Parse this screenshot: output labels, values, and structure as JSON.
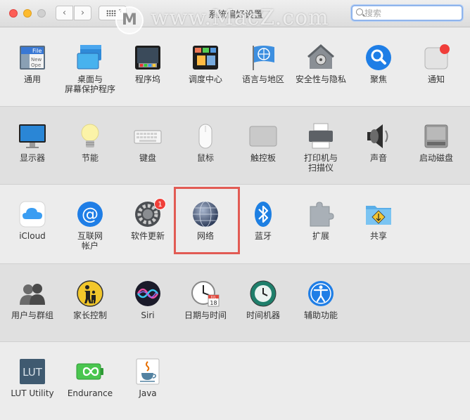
{
  "window": {
    "title": "系统偏好设置",
    "search_placeholder": "搜索",
    "back_glyph": "‹",
    "forward_glyph": "›",
    "grid_caret": "▾"
  },
  "watermark": {
    "logo": "M",
    "text": "www.MacZ.com"
  },
  "sections": [
    {
      "items": [
        {
          "key": "general",
          "label": "通用",
          "icon": "general-icon"
        },
        {
          "key": "desktop",
          "label": "桌面与\n屏幕保护程序",
          "icon": "desktop-icon"
        },
        {
          "key": "dock",
          "label": "程序坞",
          "icon": "dock-icon"
        },
        {
          "key": "mission",
          "label": "调度中心",
          "icon": "mission-control-icon"
        },
        {
          "key": "language",
          "label": "语言与地区",
          "icon": "globe-flag-icon"
        },
        {
          "key": "security",
          "label": "安全性与隐私",
          "icon": "security-house-icon"
        },
        {
          "key": "spotlight",
          "label": "聚焦",
          "icon": "spotlight-icon"
        },
        {
          "key": "notifications",
          "label": "通知",
          "icon": "notifications-icon"
        }
      ]
    },
    {
      "items": [
        {
          "key": "displays",
          "label": "显示器",
          "icon": "display-icon"
        },
        {
          "key": "energy",
          "label": "节能",
          "icon": "lightbulb-icon"
        },
        {
          "key": "keyboard",
          "label": "键盘",
          "icon": "keyboard-icon"
        },
        {
          "key": "mouse",
          "label": "鼠标",
          "icon": "mouse-icon"
        },
        {
          "key": "trackpad",
          "label": "触控板",
          "icon": "trackpad-icon"
        },
        {
          "key": "printers",
          "label": "打印机与\n扫描仪",
          "icon": "printer-icon"
        },
        {
          "key": "sound",
          "label": "声音",
          "icon": "speaker-icon"
        },
        {
          "key": "startup",
          "label": "启动磁盘",
          "icon": "disk-icon"
        }
      ]
    },
    {
      "items": [
        {
          "key": "icloud",
          "label": "iCloud",
          "icon": "icloud-icon"
        },
        {
          "key": "internet",
          "label": "互联网\n帐户",
          "icon": "at-sign-icon"
        },
        {
          "key": "software",
          "label": "软件更新",
          "icon": "gear-update-icon",
          "badge": "1"
        },
        {
          "key": "network",
          "label": "网络",
          "icon": "network-globe-icon"
        },
        {
          "key": "bluetooth",
          "label": "蓝牙",
          "icon": "bluetooth-icon"
        },
        {
          "key": "extensions",
          "label": "扩展",
          "icon": "puzzle-icon"
        },
        {
          "key": "sharing",
          "label": "共享",
          "icon": "sharing-folder-icon"
        }
      ]
    },
    {
      "items": [
        {
          "key": "users",
          "label": "用户与群组",
          "icon": "users-icon"
        },
        {
          "key": "parental",
          "label": "家长控制",
          "icon": "parental-icon"
        },
        {
          "key": "siri",
          "label": "Siri",
          "icon": "siri-icon"
        },
        {
          "key": "datetime",
          "label": "日期与时间",
          "icon": "clock-calendar-icon",
          "cal_month": "JUL",
          "cal_day": "18"
        },
        {
          "key": "timemachine",
          "label": "时间机器",
          "icon": "time-machine-icon"
        },
        {
          "key": "accessibility",
          "label": "辅助功能",
          "icon": "accessibility-icon"
        }
      ]
    },
    {
      "items": [
        {
          "key": "lut",
          "label": "LUT Utility",
          "icon": "lut-icon",
          "icon_text": "LUT"
        },
        {
          "key": "endurance",
          "label": "Endurance",
          "icon": "battery-infinity-icon"
        },
        {
          "key": "java",
          "label": "Java",
          "icon": "java-cup-icon"
        }
      ]
    }
  ],
  "general_icon_text": {
    "line1": "File",
    "line2": "New",
    "line3": "Ope"
  }
}
